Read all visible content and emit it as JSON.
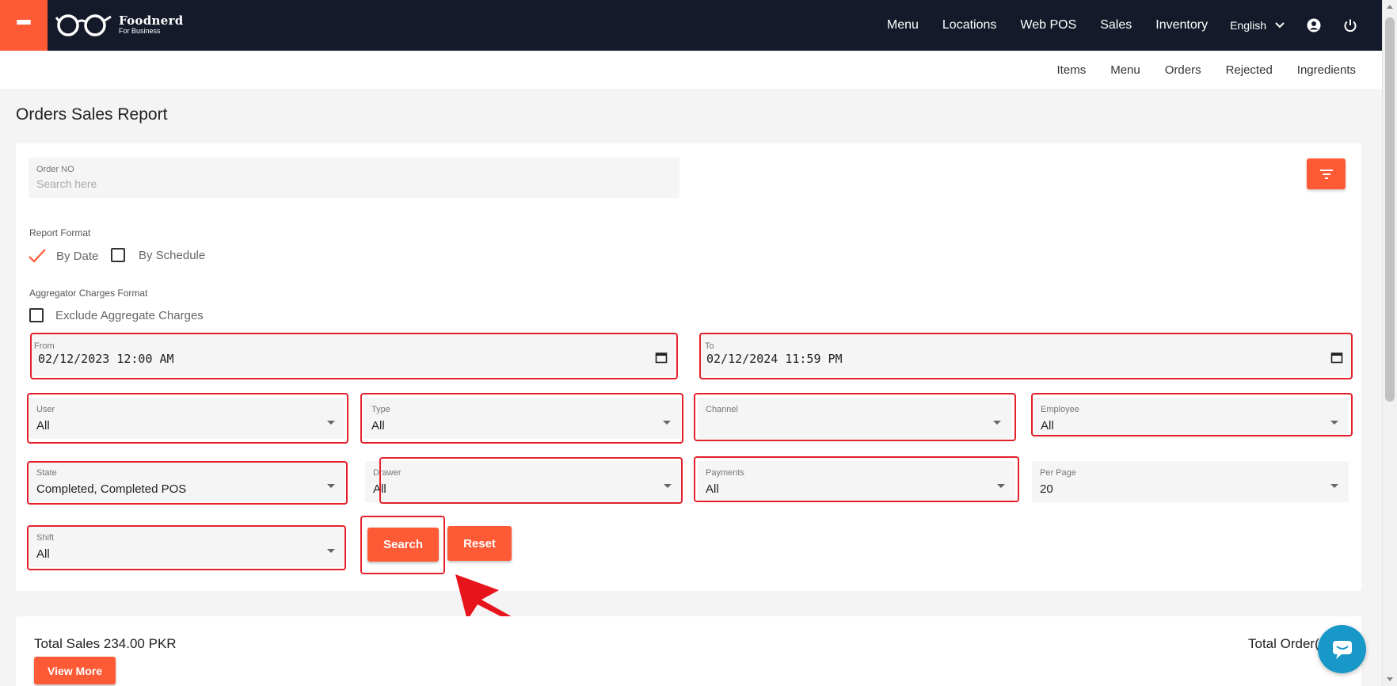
{
  "brand": {
    "name": "Foodnerd",
    "tagline": "For Business"
  },
  "topnav": {
    "links": [
      "Menu",
      "Locations",
      "Web POS",
      "Sales",
      "Inventory"
    ],
    "language": "English",
    "accent": "#ff5a36",
    "bg": "#141a29"
  },
  "subnav": {
    "links": [
      "Items",
      "Menu",
      "Orders",
      "Rejected",
      "Ingredients"
    ]
  },
  "page": {
    "title": "Orders Sales Report"
  },
  "order_no": {
    "label": "Order NO",
    "placeholder": "Search here"
  },
  "report_format": {
    "label": "Report Format",
    "options": [
      {
        "label": "By Date",
        "checked": true
      },
      {
        "label": "By Schedule",
        "checked": false
      }
    ]
  },
  "aggregator": {
    "label": "Aggregator Charges Format",
    "option": {
      "label": "Exclude Aggregate Charges",
      "checked": false
    }
  },
  "from": {
    "label": "From",
    "value": "02/12/2023 12:00 AM"
  },
  "to": {
    "label": "To",
    "value": "02/12/2024 11:59 PM"
  },
  "filters": {
    "user": {
      "label": "User",
      "value": "All"
    },
    "type": {
      "label": "Type",
      "value": "All"
    },
    "channel": {
      "label": "Channel",
      "value": ""
    },
    "employee": {
      "label": "Employee",
      "value": "All"
    },
    "state": {
      "label": "State",
      "value": "Completed, Completed POS"
    },
    "drawer": {
      "label": "Drawer",
      "value": "All"
    },
    "payments": {
      "label": "Payments",
      "value": "All"
    },
    "per_page": {
      "label": "Per Page",
      "value": "20"
    },
    "shift": {
      "label": "Shift",
      "value": "All"
    }
  },
  "buttons": {
    "search": "Search",
    "reset": "Reset",
    "view_more": "View More"
  },
  "summary": {
    "total_sales": "Total Sales 234.00 PKR",
    "total_orders": "Total Order("
  },
  "annotation_color": "#e3202a"
}
